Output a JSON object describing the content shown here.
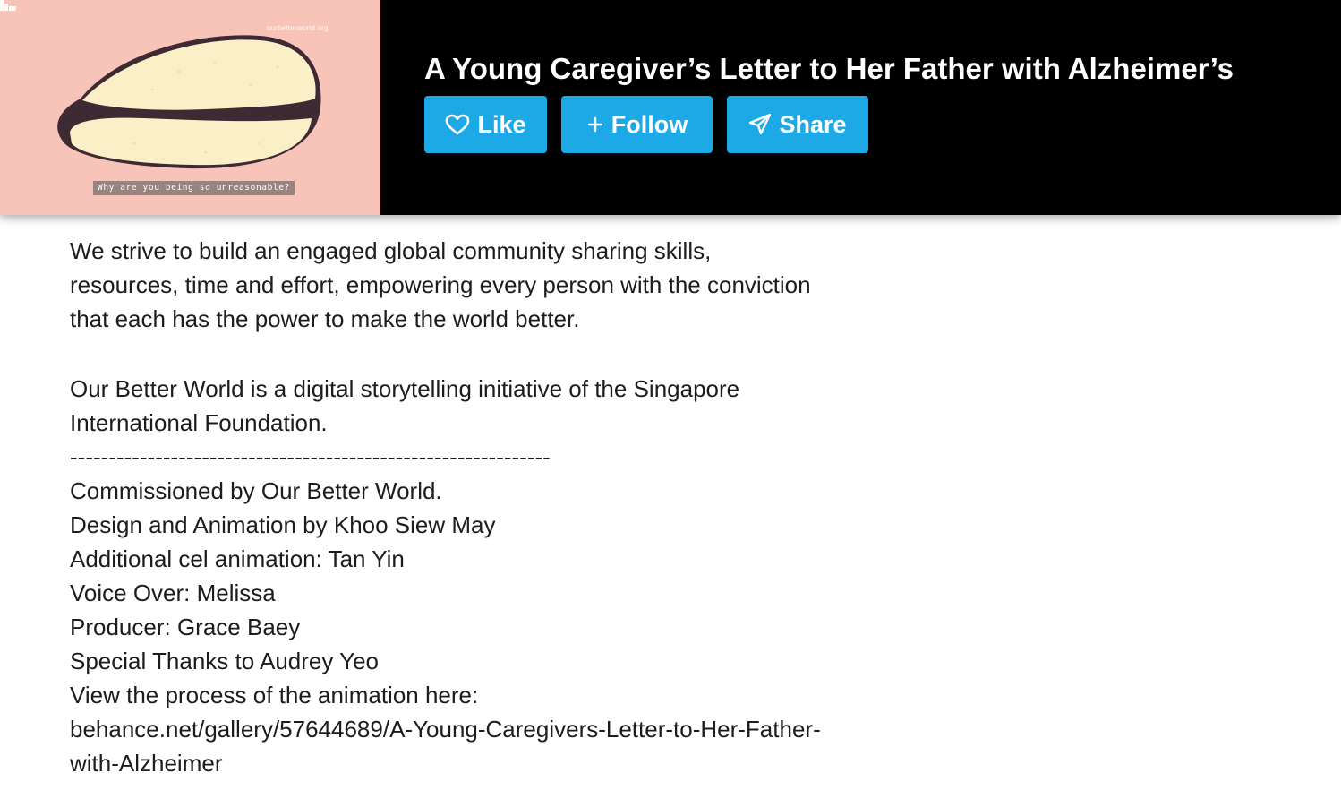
{
  "thumbnail": {
    "logo_text": "ourbetterworld.org",
    "caption": "Why are you being so unreasonable?",
    "background_color": "#f8c3b8"
  },
  "header": {
    "title": "A Young Caregiver’s Letter to Her Father with Alzheimer’s",
    "buttons": {
      "like_label": "Like",
      "follow_label": "Follow",
      "share_label": "Share"
    },
    "icons": {
      "like": "heart-icon",
      "follow": "plus-icon",
      "share": "paper-plane-icon"
    },
    "accent_color": "#1da8e6"
  },
  "description": {
    "para1": [
      "We strive to build an engaged global community sharing skills,",
      "resources, time and effort, empowering every person with the conviction",
      "that each has the power to make the world better."
    ],
    "para2": [
      "Our Better World is a digital storytelling initiative of the Singapore",
      "International Foundation."
    ],
    "divider": "--------------------------------------------------------------",
    "credits": [
      "Commissioned by Our Better World.",
      "Design and Animation by Khoo Siew May",
      "Additional cel animation: Tan Yin",
      "Voice Over: Melissa",
      "Producer: Grace Baey",
      "Special Thanks to Audrey Yeo",
      "View the process of the animation here:"
    ],
    "link_lines": [
      "behance.net/gallery/57644689/A-Young-Caregivers-Letter-to-Her-Father-",
      "with-Alzheimer"
    ]
  }
}
